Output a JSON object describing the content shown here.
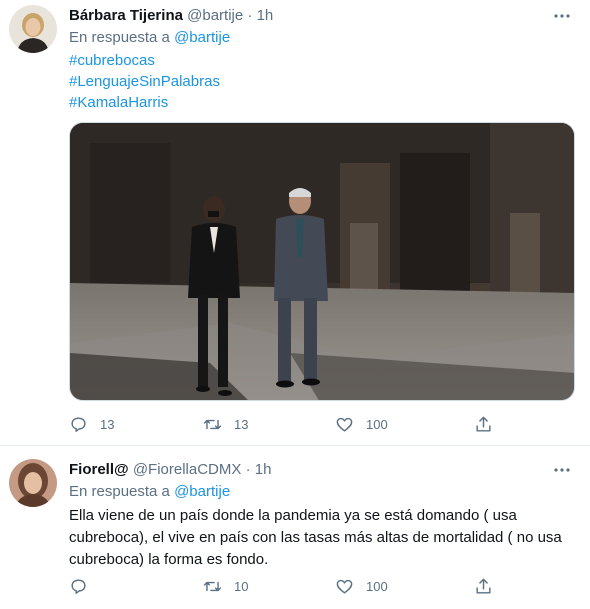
{
  "tweets": [
    {
      "name": "Bárbara Tijerina",
      "handle": "@bartije",
      "dot": "·",
      "time": "1h",
      "reply_prefix": "En respuesta a",
      "reply_handle": "@bartije",
      "hashtags": [
        "#cubrebocas",
        "#LenguajeSinPalabras",
        "#KamalaHarris"
      ],
      "actions": {
        "reply_count": "13",
        "retweet_count": "13",
        "like_count": "100"
      }
    },
    {
      "name": "Fiorell@",
      "handle": "@FiorellaCDMX",
      "dot": "·",
      "time": "1h",
      "reply_prefix": "En respuesta a",
      "reply_handle": "@bartije",
      "text": "Ella viene de un país donde la pandemia ya se está domando ( usa cubreboca), el vive en país con las tasas más altas de mortalidad ( no usa cubreboca) la forma es fondo.",
      "actions": {
        "reply_count": "",
        "retweet_count": "10",
        "like_count": "100"
      }
    }
  ],
  "icons": {
    "more": "more-icon",
    "reply": "reply-icon",
    "retweet": "retweet-icon",
    "like": "like-icon",
    "share": "share-icon"
  },
  "colors": {
    "link": "#1b95e0",
    "secondary_text": "#5b7083",
    "primary_text": "#0f1419",
    "divider": "#e6ecf0"
  }
}
